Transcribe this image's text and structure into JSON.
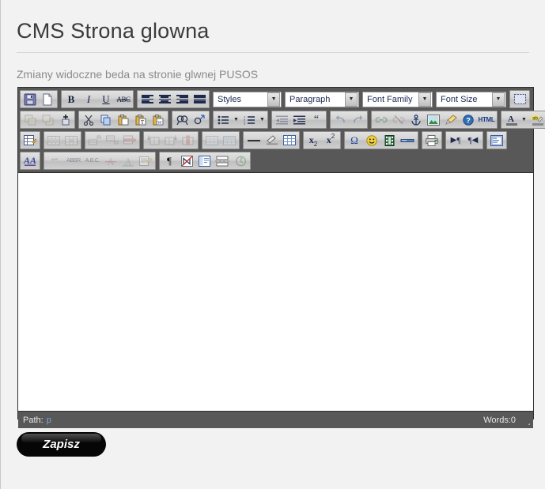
{
  "page": {
    "title": "CMS Strona glowna",
    "subtitle": "Zmiany widoczne beda na stronie glwnej PUSOS",
    "background_color": "#f2f2f2",
    "title_color": "#3b3b3b",
    "subtitle_color": "#8a8a8a"
  },
  "editor": {
    "toolbar_background": "#585858",
    "content_background": "#ffffff",
    "content_text": "",
    "dropdowns": {
      "styles": "Styles",
      "paragraph": "Paragraph",
      "font_family": "Font Family",
      "font_size": "Font Size"
    },
    "toolbar_rows": [
      {
        "row": 1,
        "groups": [
          {
            "buttons": [
              "save-icon",
              "new-document-icon"
            ]
          },
          {
            "buttons": [
              "bold-icon",
              "italic-icon",
              "underline-icon",
              "strikethrough-icon"
            ]
          },
          {
            "buttons": [
              "align-left-icon",
              "align-center-icon",
              "align-right-icon",
              "align-justify-icon"
            ]
          }
        ],
        "selects": [
          "styles",
          "paragraph",
          "font_family",
          "font_size"
        ],
        "trailing_buttons": [
          "select-all-icon"
        ]
      },
      {
        "row": 2,
        "groups": [
          {
            "buttons": [
              "layer-back-icon",
              "layer-front-icon",
              "layer-add-icon"
            ]
          },
          {
            "buttons": [
              "cut-icon",
              "copy-icon",
              "paste-icon",
              "paste-text-icon",
              "paste-word-icon"
            ]
          },
          {
            "buttons": [
              "search-icon",
              "replace-icon"
            ]
          },
          {
            "buttons": [
              "bullet-list-icon",
              "bullet-list-dropdown-icon",
              "numbered-list-icon",
              "numbered-list-dropdown-icon"
            ]
          },
          {
            "buttons": [
              "outdent-icon",
              "indent-icon",
              "blockquote-icon"
            ]
          },
          {
            "buttons": [
              "undo-icon",
              "redo-icon"
            ]
          },
          {
            "buttons": [
              "link-icon",
              "unlink-icon",
              "anchor-icon",
              "image-icon",
              "cleanup-icon",
              "help-icon",
              "html-source-icon"
            ]
          },
          {
            "buttons": [
              "text-color-icon",
              "text-color-dropdown-icon",
              "background-color-icon",
              "background-color-dropdown-icon"
            ]
          }
        ]
      },
      {
        "row": 3,
        "groups": [
          {
            "buttons": [
              "edit-table-icon"
            ]
          },
          {
            "buttons": [
              "table-row-properties-icon",
              "table-cell-properties-icon"
            ]
          },
          {
            "buttons": [
              "insert-row-before-icon",
              "insert-row-after-icon",
              "delete-row-icon"
            ]
          },
          {
            "buttons": [
              "insert-column-before-icon",
              "insert-column-after-icon",
              "delete-column-icon"
            ]
          },
          {
            "buttons": [
              "split-cells-icon",
              "merge-cells-icon"
            ]
          },
          {
            "buttons": [
              "horizontal-rule-icon",
              "remove-format-icon",
              "visual-aid-icon"
            ]
          },
          {
            "buttons": [
              "subscript-icon",
              "superscript-icon"
            ]
          },
          {
            "buttons": [
              "special-character-icon",
              "emoticon-icon",
              "media-icon",
              "page-break-icon"
            ]
          },
          {
            "buttons": [
              "print-icon"
            ]
          },
          {
            "buttons": [
              "direction-ltr-icon",
              "direction-rtl-icon"
            ]
          },
          {
            "buttons": [
              "fullscreen-icon"
            ]
          }
        ]
      },
      {
        "row": 4,
        "groups": [
          {
            "buttons": [
              "style-props-icon"
            ]
          },
          {
            "buttons": [
              "citation-icon",
              "abbreviation-icon",
              "acronym-icon",
              "deletion-icon",
              "insertion-icon",
              "attributes-icon"
            ]
          },
          {
            "buttons": [
              "show-invisible-chars-icon",
              "nonbreaking-icon",
              "template-icon",
              "page-break-2-icon",
              "restore-draft-icon"
            ]
          }
        ]
      }
    ],
    "statusbar": {
      "path_label": "Path:",
      "path_value": "p",
      "word_count": "Words:0",
      "path_value_color": "#7ea6e0"
    }
  },
  "actions": {
    "save_label": "Zapisz",
    "save_background": "#060606",
    "save_text_color": "#ffffff"
  }
}
